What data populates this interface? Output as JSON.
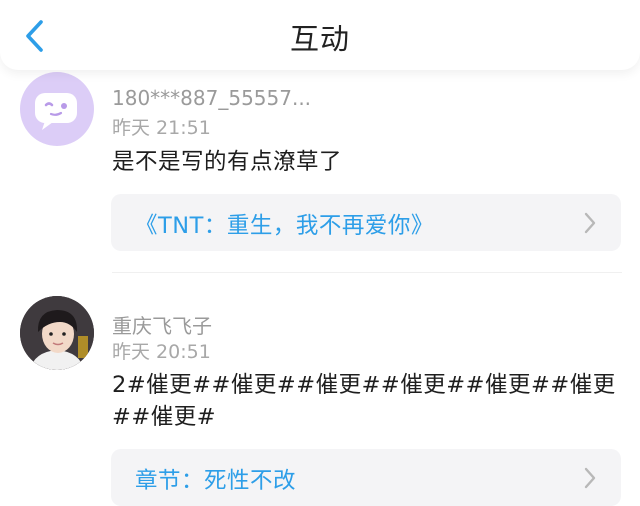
{
  "header": {
    "title": "互动"
  },
  "comments": [
    {
      "username": "180***887_55557...",
      "time": "昨天 21:51",
      "content": "是不是写的有点潦草了",
      "ref": "《TNT：重生，我不再爱你》",
      "avatar_icon": "chat-bubble-icon"
    },
    {
      "username": "重庆飞飞子",
      "time": "昨天 20:51",
      "content": "2#催更##催更##催更##催更##催更##催更##催更#",
      "ref": "章节：死性不改",
      "avatar_icon": "user-photo-avatar"
    }
  ],
  "colors": {
    "accent": "#2d9ee8",
    "avatar_bg": "#dccdf7"
  }
}
